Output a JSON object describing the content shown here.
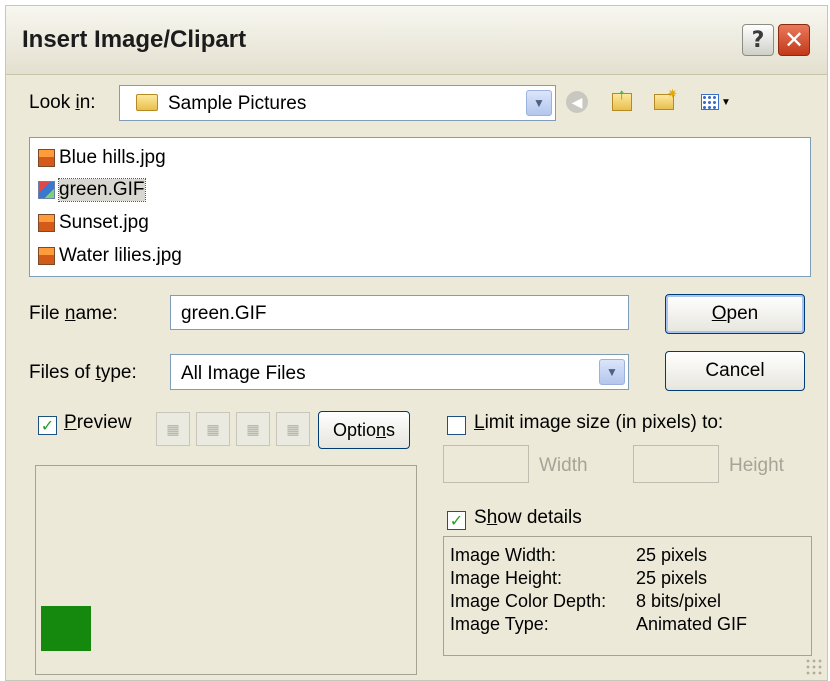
{
  "window": {
    "title": "Insert Image/Clipart",
    "help_label": "?",
    "close_label": "✕"
  },
  "lookin": {
    "label_pre": "Look ",
    "label_u": "i",
    "label_post": "n:",
    "value": "Sample Pictures",
    "toolbar_icons": [
      "back-icon",
      "up-folder-icon",
      "new-folder-icon",
      "view-menu-icon"
    ]
  },
  "files": [
    {
      "name": "Blue hills.jpg",
      "type": "jpg"
    },
    {
      "name": "green.GIF",
      "type": "gif",
      "selected": true
    },
    {
      "name": "Sunset.jpg",
      "type": "jpg"
    },
    {
      "name": "Water lilies.jpg",
      "type": "jpg"
    }
  ],
  "filename": {
    "label_pre": "File ",
    "label_u": "n",
    "label_post": "ame:",
    "value": "green.GIF"
  },
  "filetype": {
    "label_pre": "Files of ",
    "label_u": "t",
    "label_post": "ype:",
    "value": "All Image Files"
  },
  "buttons": {
    "open_u": "O",
    "open_rest": "pen",
    "cancel": "Cancel"
  },
  "preview": {
    "checked": true,
    "label_u": "P",
    "label_rest": "review",
    "options_pre": "Optio",
    "options_u": "n",
    "options_post": "s",
    "swatch_color": "#15890e"
  },
  "limit": {
    "checked": false,
    "label_u": "L",
    "label_rest": "imit image size (in pixels) to:",
    "width_label": "Width",
    "height_label": "Height"
  },
  "details": {
    "checked": true,
    "label_pre": "S",
    "label_u": "h",
    "label_post": "ow details",
    "rows": [
      {
        "key": "Image Width:",
        "value": "25 pixels"
      },
      {
        "key": "Image Height:",
        "value": "25 pixels"
      },
      {
        "key": "Image Color Depth:",
        "value": "8 bits/pixel"
      },
      {
        "key": "Image Type:",
        "value": "Animated GIF"
      }
    ]
  }
}
